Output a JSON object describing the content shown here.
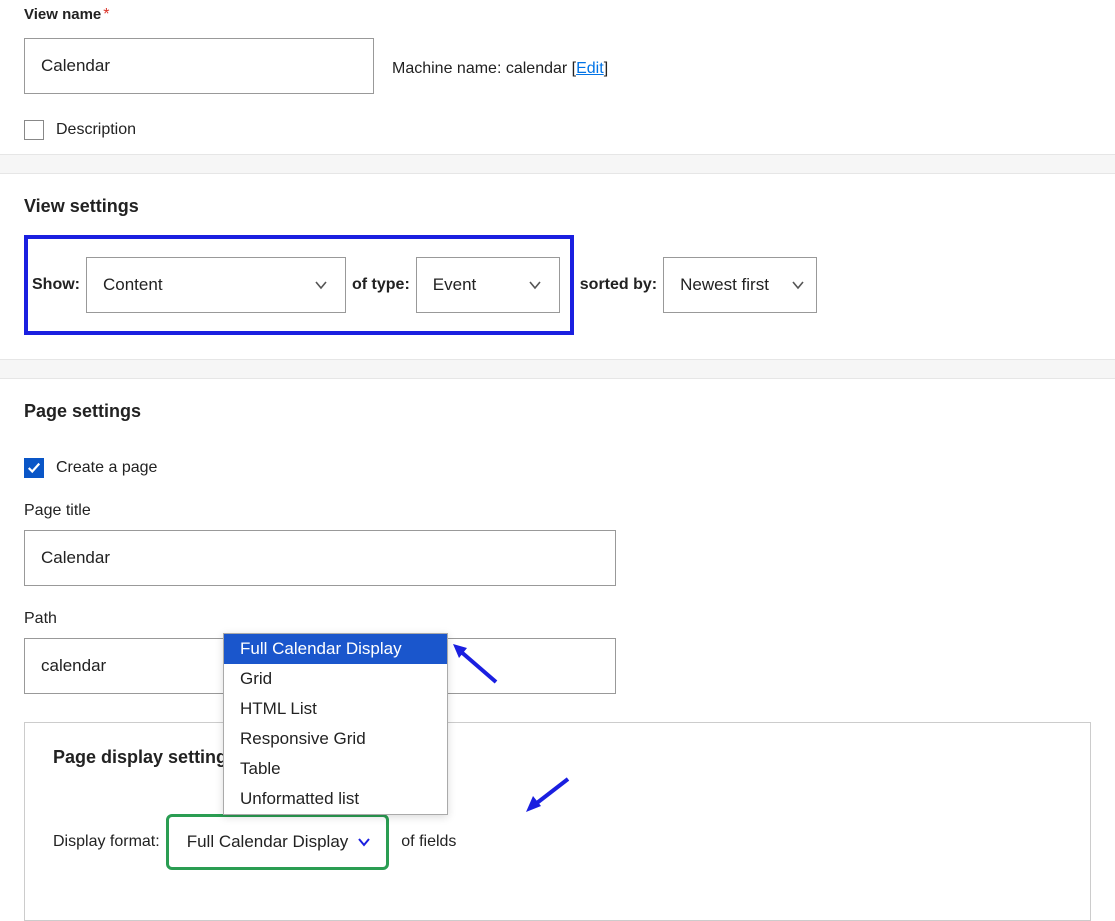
{
  "viewName": {
    "label": "View name",
    "value": "Calendar",
    "machineLabel": "Machine name:",
    "machineValue": "calendar",
    "editLabel": "Edit"
  },
  "description": {
    "label": "Description",
    "checked": false
  },
  "viewSettings": {
    "heading": "View settings",
    "showLabel": "Show:",
    "showValue": "Content",
    "ofTypeLabel": "of type:",
    "ofTypeValue": "Event",
    "sortedByLabel": "sorted by:",
    "sortedByValue": "Newest first"
  },
  "pageSettings": {
    "heading": "Page settings",
    "createPageLabel": "Create a page",
    "createPageChecked": true,
    "pageTitleLabel": "Page title",
    "pageTitleValue": "Calendar",
    "pathLabel": "Path",
    "pathValue": "calendar"
  },
  "displaySettings": {
    "heading": "Page display settings",
    "formatLabel": "Display format:",
    "formatValue": "Full Calendar Display",
    "ofLabel": "of fields",
    "options": {
      "o0": "Full Calendar Display",
      "o1": "Grid",
      "o2": "HTML List",
      "o3": "Responsive Grid",
      "o4": "Table",
      "o5": "Unformatted list"
    }
  }
}
